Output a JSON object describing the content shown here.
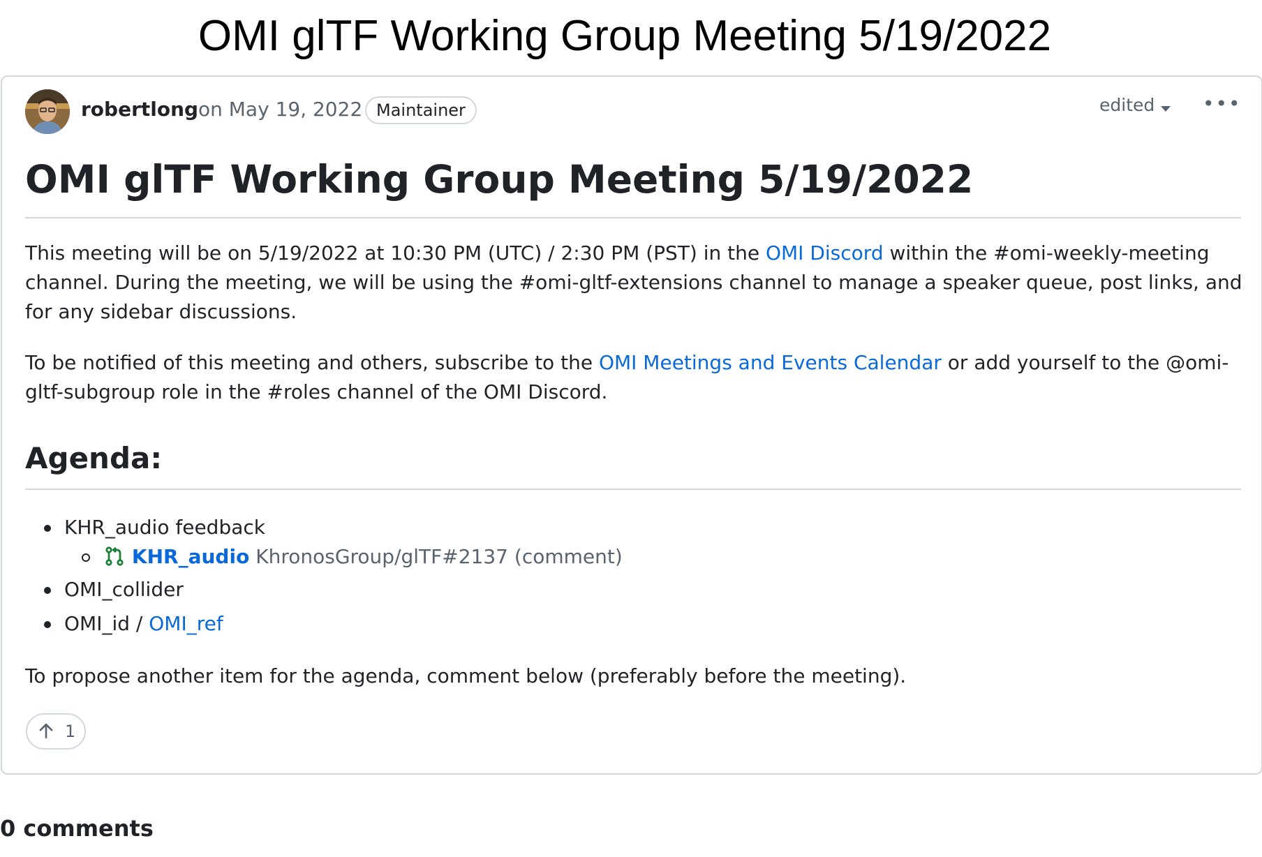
{
  "page_title": "OMI glTF Working Group Meeting 5/19/2022",
  "post": {
    "author": "robertlong",
    "date": "on May 19, 2022",
    "role_badge": "Maintainer",
    "edited_label": "edited",
    "menu_icon": "kebab-horizontal-icon",
    "heading": "OMI glTF Working Group Meeting 5/19/2022",
    "intro": {
      "part1": "This meeting will be on 5/19/2022 at 10:30 PM (UTC) / 2:30 PM (PST) in the ",
      "link": "OMI Discord",
      "part2": " within the #omi-weekly-meeting channel. During the meeting, we will be using the #omi-gltf-extensions channel to manage a speaker queue, post links, and for any sidebar discussions."
    },
    "notify": {
      "part1": "To be notified of this meeting and others, subscribe to the ",
      "link": "OMI Meetings and Events Calendar",
      "part2": " or add yourself to the @omi-gltf-subgroup role in the #roles channel of the OMI Discord."
    },
    "agenda_heading": "Agenda:",
    "agenda": {
      "item1": "KHR_audio feedback",
      "item1_sub": {
        "icon": "git-pull-request-icon",
        "pr_title": "KHR_audio",
        "pr_ref": "KhronosGroup/glTF#2137",
        "pr_note": "(comment)"
      },
      "item2": "OMI_collider",
      "item3_text": "OMI_id / ",
      "item3_link": "OMI_ref"
    },
    "closing": "To propose another item for the agenda, comment below (preferably before the meeting).",
    "reaction": {
      "icon": "arrow-up-icon",
      "count": "1"
    }
  },
  "comments_label": "0 comments",
  "colors": {
    "link": "#0969da",
    "pr_icon": "#1a7f37",
    "border": "#d0d7de",
    "muted": "#59636e"
  }
}
